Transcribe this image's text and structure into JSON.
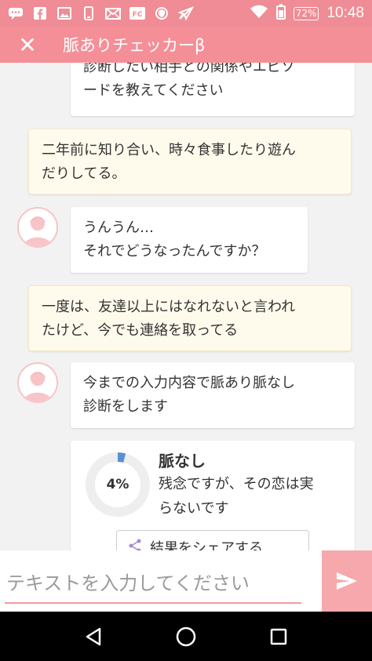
{
  "status_bar": {
    "icons": [
      "chat-icon",
      "facebook-icon",
      "image-icon",
      "phone-icon",
      "mail-icon",
      "fc-icon",
      "shield-icon",
      "send-icon",
      "wifi-icon",
      "battery-icon"
    ],
    "fc_label": "FC",
    "battery": "72%",
    "time": "10:48"
  },
  "header": {
    "close_label": "✕",
    "title": "脈ありチェッカーβ"
  },
  "messages": [
    {
      "role": "bot",
      "lines": [
        "診断したい相手との関係やエピソ",
        "ードを教えてください"
      ]
    },
    {
      "role": "user",
      "lines": [
        "二年前に知り合い、時々食事したり遊ん",
        "だりしてる。"
      ]
    },
    {
      "role": "bot",
      "lines": [
        "うんうん…",
        "それでどうなったんですか？"
      ]
    },
    {
      "role": "user",
      "lines": [
        "一度は、友達以上にはなれないと言われ",
        "たけど、今でも連絡を取ってる"
      ]
    },
    {
      "role": "bot",
      "lines": [
        "今までの入力内容で脈あり脈なし",
        "診断をします"
      ]
    }
  ],
  "result": {
    "percent_label": "4%",
    "percent": 4,
    "title": "脈なし",
    "text_lines": [
      "残念ですが、その恋は実",
      "らないです"
    ],
    "share_label": "結果をシェアする"
  },
  "input": {
    "placeholder": "テキストを入力してください",
    "value": ""
  },
  "colors": {
    "header": "#f48f97",
    "accent": "#f29aa1",
    "user_bubble": "#fffbec",
    "gauge": "#5a8fd8",
    "gauge_track": "#eeeeee"
  }
}
